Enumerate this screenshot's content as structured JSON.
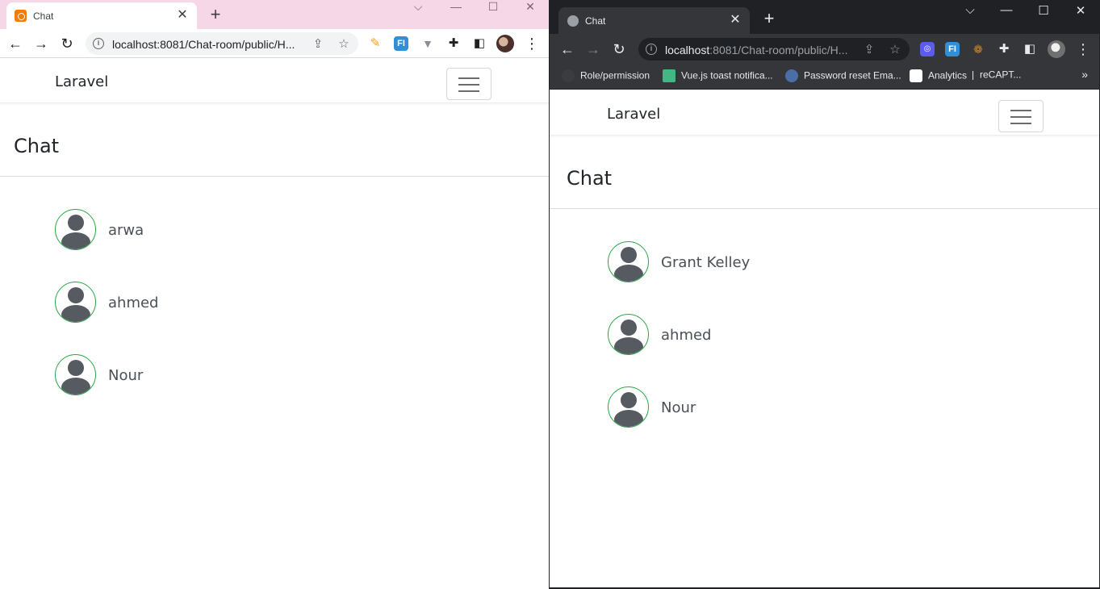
{
  "left_window": {
    "tab": {
      "title": "Chat",
      "close": "✕"
    },
    "new_tab": "+",
    "window_controls": {
      "menu": "⌵",
      "minimize": "—",
      "maximize": "☐",
      "close": "✕"
    },
    "address": {
      "url": "localhost:8081/Chat-room/public/H..."
    },
    "page": {
      "brand": "Laravel",
      "heading": "Chat",
      "users": [
        "arwa",
        "ahmed",
        "Nour"
      ]
    }
  },
  "right_window": {
    "tab": {
      "title": "Chat",
      "close": "✕"
    },
    "new_tab": "+",
    "window_controls": {
      "menu": "⌵",
      "minimize": "—",
      "maximize": "☐",
      "close": "✕"
    },
    "address": {
      "url_host": "localhost",
      "url_rest": ":8081/Chat-room/public/H..."
    },
    "bookmarks": [
      "Role/permission",
      "Vue.js toast notifica...",
      "Password reset Ema...",
      "Analytics",
      "|",
      "reCAPT..."
    ],
    "bookmarks_more": "»",
    "page": {
      "brand": "Laravel",
      "heading": "Chat",
      "users": [
        "Grant Kelley",
        "ahmed",
        "Nour"
      ]
    }
  },
  "colors": {
    "left_tabstrip": "#f6d7e7",
    "right_tabstrip": "#202124",
    "avatar_border": "#28a745",
    "avatar_fill": "#555b61"
  }
}
